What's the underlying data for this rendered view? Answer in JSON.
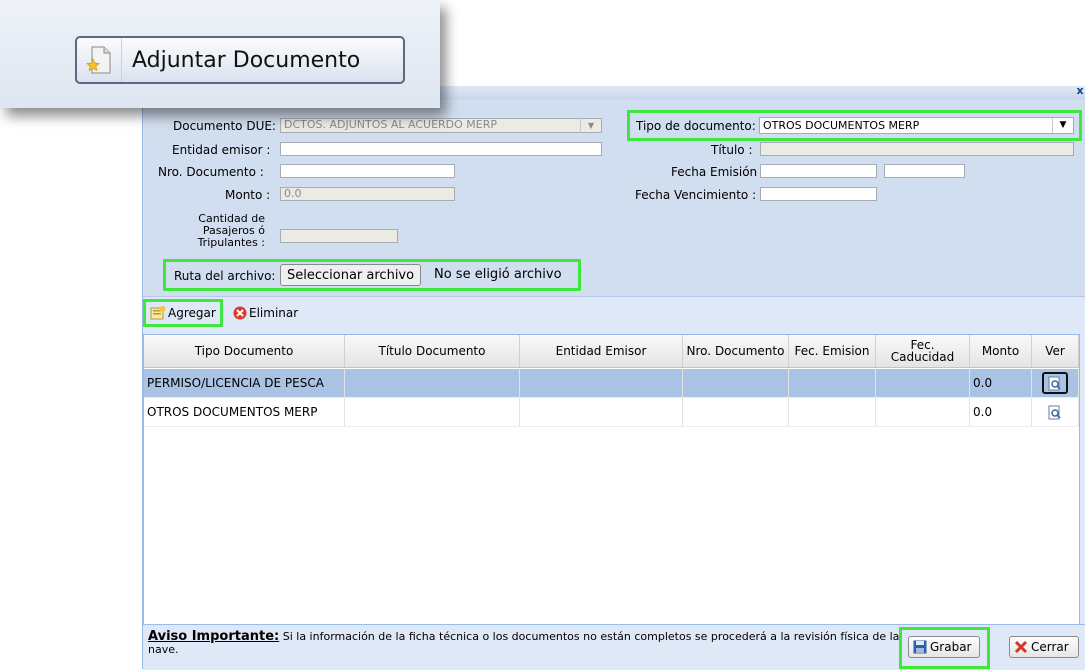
{
  "callout": {
    "label": "Adjuntar Documento"
  },
  "dialog": {
    "close_symbol": "x"
  },
  "form": {
    "documento_due_label": "Documento DUE:",
    "documento_due_value": "DCTOS. ADJUNTOS AL ACUERDO MERP",
    "tipo_documento_label": "Tipo de documento:",
    "tipo_documento_value": "OTROS DOCUMENTOS MERP",
    "entidad_emisor_label": "Entidad emisor :",
    "entidad_emisor_value": "",
    "titulo_label": "Título :",
    "titulo_value": "",
    "nro_documento_label": "Nro. Documento :",
    "nro_documento_value": "",
    "fecha_emision_label": "Fecha Emisión :",
    "fecha_emision_value": "",
    "fecha_emision_value2": "",
    "monto_label": "Monto :",
    "monto_value": "0.0",
    "fecha_vencimiento_label": "Fecha Vencimiento :",
    "fecha_vencimiento_value": "",
    "cantidad_label_1": "Cantidad de",
    "cantidad_label_2": "Pasajeros ó",
    "cantidad_label_3": "Tripulantes :",
    "cantidad_value": "",
    "ruta_label": "Ruta del archivo:",
    "file_button": "Seleccionar archivo",
    "file_status": "No se eligió archivo"
  },
  "toolbar": {
    "agregar": "Agregar",
    "eliminar": "Eliminar"
  },
  "grid": {
    "columns": [
      "Tipo Documento",
      "Título Documento",
      "Entidad Emisor",
      "Nro. Documento",
      "Fec. Emision",
      "Fec.",
      "Caducidad",
      "Monto",
      "Ver"
    ],
    "rows": [
      {
        "tipo": "PERMISO/LICENCIA DE PESCA",
        "titulo": "",
        "entidad": "",
        "nro": "",
        "emision": "",
        "caducidad": "",
        "monto": "0.0"
      },
      {
        "tipo": "OTROS DOCUMENTOS MERP",
        "titulo": "",
        "entidad": "",
        "nro": "",
        "emision": "",
        "caducidad": "",
        "monto": "0.0"
      }
    ]
  },
  "footer": {
    "aviso_title": "Aviso Importante:",
    "aviso_text": " Si la información de la ficha técnica o los documentos no están completos se procederá a la revisión física de la nave.",
    "grabar": "Grabar",
    "cerrar": "Cerrar"
  },
  "colors": {
    "highlight": "#3ee63e",
    "selected_row": "#a9c3e4",
    "panel": "#d1deef"
  }
}
